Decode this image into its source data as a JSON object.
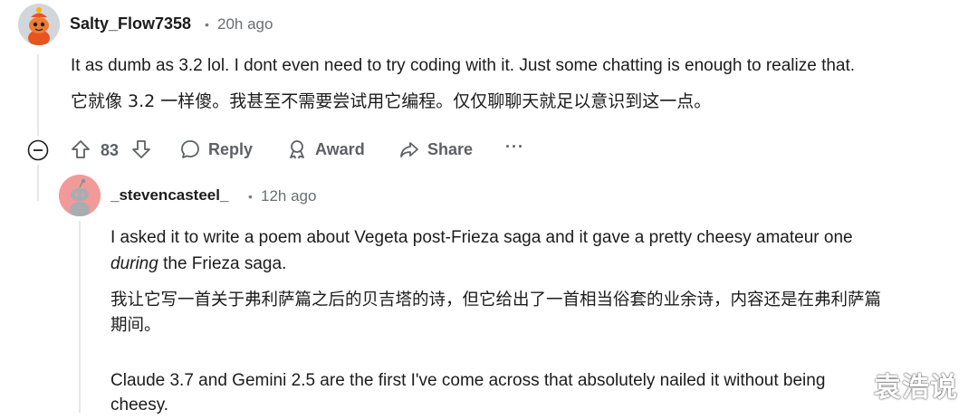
{
  "comment": {
    "username": "Salty_Flow7358",
    "separator": "•",
    "timestamp": "20h ago",
    "text_en": "It as dumb as 3.2 lol. I dont even need to try coding with it. Just some chatting is enough to realize that.",
    "text_zh": "它就像 3.2 一样傻。我甚至不需要尝试用它编程。仅仅聊聊天就足以意识到这一点。",
    "actions": {
      "collapse_icon": "collapse-icon",
      "upvote_icon": "upvote-icon",
      "vote_count": "83",
      "downvote_icon": "downvote-icon",
      "reply_label": "Reply",
      "award_label": "Award",
      "share_label": "Share",
      "more_label": "···"
    }
  },
  "reply": {
    "username": "_stevencasteel_",
    "separator": "•",
    "timestamp": "12h ago",
    "text_en_line1": "I asked it to write a poem about Vegeta post-Frieza saga and it gave a pretty cheesy amateur one",
    "text_en_line2_italic": "during",
    "text_en_line2_rest": " the Frieza saga.",
    "text_zh_line1": "我让它写一首关于弗利萨篇之后的贝吉塔的诗，但它给出了一首相当俗套的业余诗，内容还是在弗利萨篇",
    "text_zh_line2": "期间。",
    "text_en2_line1": "Claude 3.7 and Gemini 2.5 are the first I've come across that absolutely nailed it without being",
    "text_en2_line2": "cheesy."
  },
  "watermark": "袁浩说",
  "colors": {
    "text": "#1c1c1c",
    "meta": "#6a6f74",
    "action": "#5c6166",
    "thread_line": "#e5e7ea",
    "avatar1_bg": "#d2d6da",
    "avatar2_bg": "#f29a9a"
  }
}
